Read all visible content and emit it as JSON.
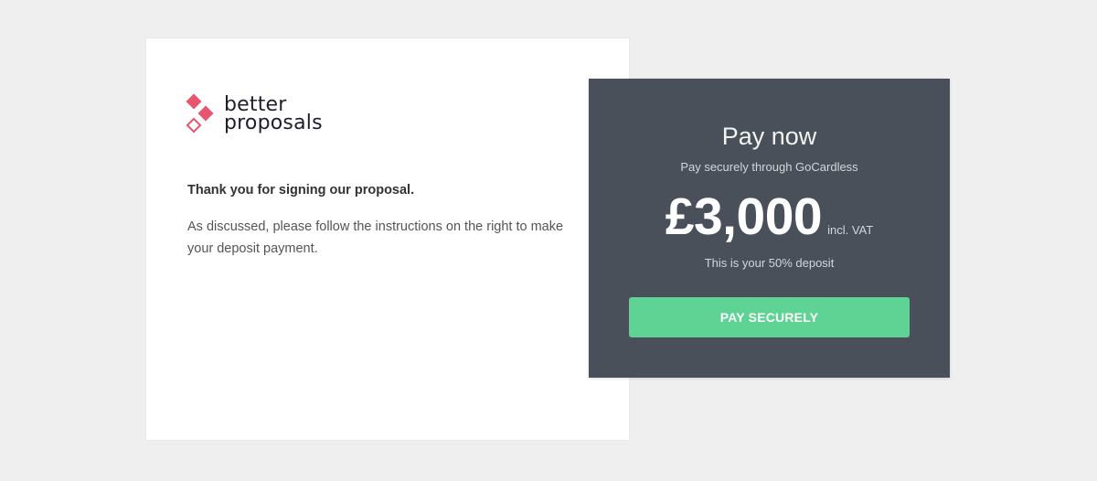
{
  "logo": {
    "line1": "better",
    "line2": "proposals",
    "brand_color": "#e8556f"
  },
  "message": {
    "heading": "Thank you for signing our proposal.",
    "body": "As discussed, please follow the instructions on the right to make your deposit payment."
  },
  "payment": {
    "title": "Pay now",
    "subtitle": "Pay securely through GoCardless",
    "amount": "£3,000",
    "tax_note": "incl. VAT",
    "deposit_note": "This is your 50% deposit",
    "button_label": "PAY SECURELY",
    "panel_color": "#4a505a",
    "button_color": "#5ed394"
  }
}
